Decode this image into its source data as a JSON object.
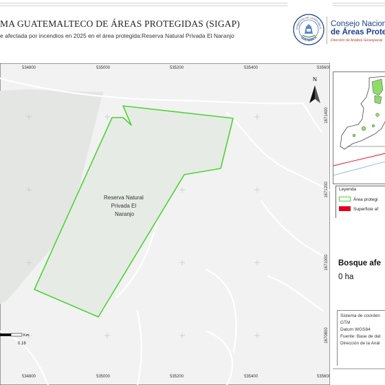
{
  "header": {
    "title": "MA GUATEMALTECO DE ÁREAS PROTEGIDAS  (SIGAP)",
    "subtitle": "e afectada por incendios en 2025 en el área protegida:Reserva Natural Privada El Naranjo",
    "institution_line1": "Consejo Nacional",
    "institution_line2": "de Áreas Protegi",
    "institution_line3": "Dirección de Análisis Geoespacial",
    "seal_text": "GOBIERNO DE LA REPÚBLICA",
    "seal_country": "GUATEMALA"
  },
  "map": {
    "x_ticks": [
      "534800",
      "535000",
      "535200",
      "535400",
      "535600"
    ],
    "y_ticks": [
      "1671400",
      "1671200",
      "1671000",
      "1670800"
    ],
    "area_label": [
      "Reserva Natural",
      "Privada El",
      "Naranjo"
    ],
    "north_label": "N",
    "scale_unit": "Km",
    "scale_value": "0.16",
    "area_outline_color": "#4cd432",
    "background_color": "#f2f2f2"
  },
  "legend": {
    "title": "Leyenda",
    "items": [
      {
        "label": "Área protegi",
        "swatch": "#4cd432"
      },
      {
        "label": "Superficie af",
        "swatch": "#e8001c"
      }
    ]
  },
  "forest": {
    "title": "Bosque afe",
    "value": "0 ha"
  },
  "metadata": [
    "Sistema de coorden",
    "GTM",
    "Datum WGS84",
    "Fuente: Base de dat",
    "Dirección de la Anál"
  ]
}
